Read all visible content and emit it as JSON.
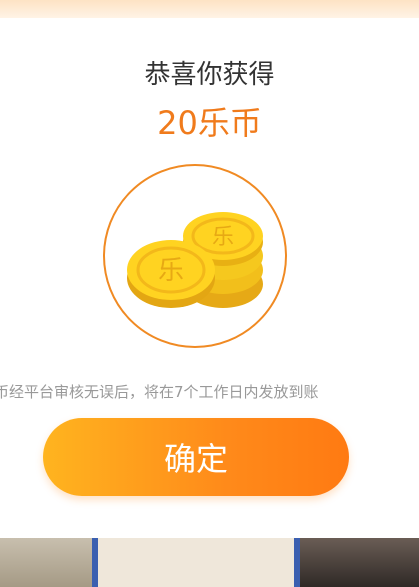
{
  "dialog": {
    "title": "恭喜你获得",
    "amount": "20乐币",
    "coin_glyph": "乐",
    "notice": "币经平台审核无误后，将在7个工作日内发放到账",
    "confirm_label": "确定"
  },
  "colors": {
    "accent": "#f07b1c",
    "ring": "#f08a23",
    "coin": "#ffd321",
    "button_start": "#ffb41f",
    "button_end": "#ff7a12"
  }
}
